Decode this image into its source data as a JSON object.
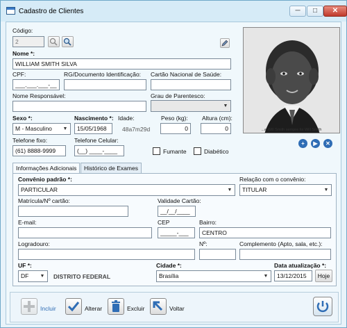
{
  "window": {
    "title": "Cadastro de Clientes",
    "min_label": "─",
    "max_label": "□",
    "close_label": "✕"
  },
  "form": {
    "codigo_label": "Código:",
    "codigo_value": "2",
    "nome_label": "Nome *:",
    "nome_value": "WILLIAM SMITH SILVA",
    "cpf_label": "CPF:",
    "cpf_value": "___.___.___-__",
    "rg_label": "RG/Documento Identificação:",
    "rg_value": "",
    "cns_label": "Cartão Nacional de Saúde:",
    "cns_value": "",
    "responsavel_label": "Nome Responsável:",
    "responsavel_value": "",
    "parentesco_label": "Grau de Parentesco:",
    "parentesco_value": "",
    "sexo_label": "Sexo *:",
    "sexo_value": "M - Masculino",
    "nascimento_label": "Nascimento *:",
    "nascimento_value": "15/05/1968",
    "idade_label": "Idade:",
    "idade_value": "48a7m29d",
    "peso_label": "Peso (kg):",
    "peso_value": "0",
    "altura_label": "Altura (cm):",
    "altura_value": "0",
    "tel_fixo_label": "Telefone fixo:",
    "tel_fixo_value": "(61) 8888-9999",
    "tel_cel_label": "Telefone Celular:",
    "tel_cel_value": "(__) ____-____",
    "fumante_label": "Fumante",
    "diabetico_label": "Diabético",
    "photo_caption": "...e Will Smith sempre foi Will Smith"
  },
  "tabs": {
    "tab1": "Informações Adicionais",
    "tab2": "Histórico de Exames"
  },
  "info": {
    "convenio_label": "Convênio padrão *:",
    "convenio_value": "PARTICULAR",
    "relacao_label": "Relação com o convênio:",
    "relacao_value": "TITULAR",
    "matricula_label": "Matrícula/Nº cartão:",
    "matricula_value": "",
    "validade_label": "Validade Cartão:",
    "validade_value": "__/__/____",
    "email_label": "E-mail:",
    "email_value": "",
    "cep_label": "CEP",
    "cep_value": "_____-___",
    "bairro_label": "Bairro:",
    "bairro_value": "CENTRO",
    "logradouro_label": "Logradouro:",
    "logradouro_value": "",
    "numero_label": "Nº:",
    "numero_value": "",
    "complemento_label": "Complemento (Apto, sala, etc.):",
    "complemento_value": "",
    "uf_label": "UF *:",
    "uf_value": "DF",
    "uf_name": "DISTRITO FEDERAL",
    "cidade_label": "Cidade *:",
    "cidade_value": "Brasília",
    "data_atual_label": "Data atualização *:",
    "data_atual_value": "13/12/2015",
    "hoje_label": "Hoje"
  },
  "actions": {
    "incluir": "Incluir",
    "alterar": "Alterar",
    "excluir": "Excluir",
    "voltar": "Voltar"
  },
  "colors": {
    "title_bg": "#d6ebf7",
    "client_bg": "#f0f8fc",
    "accent_blue": "#2f6db5",
    "close_red": "#c0392b"
  }
}
